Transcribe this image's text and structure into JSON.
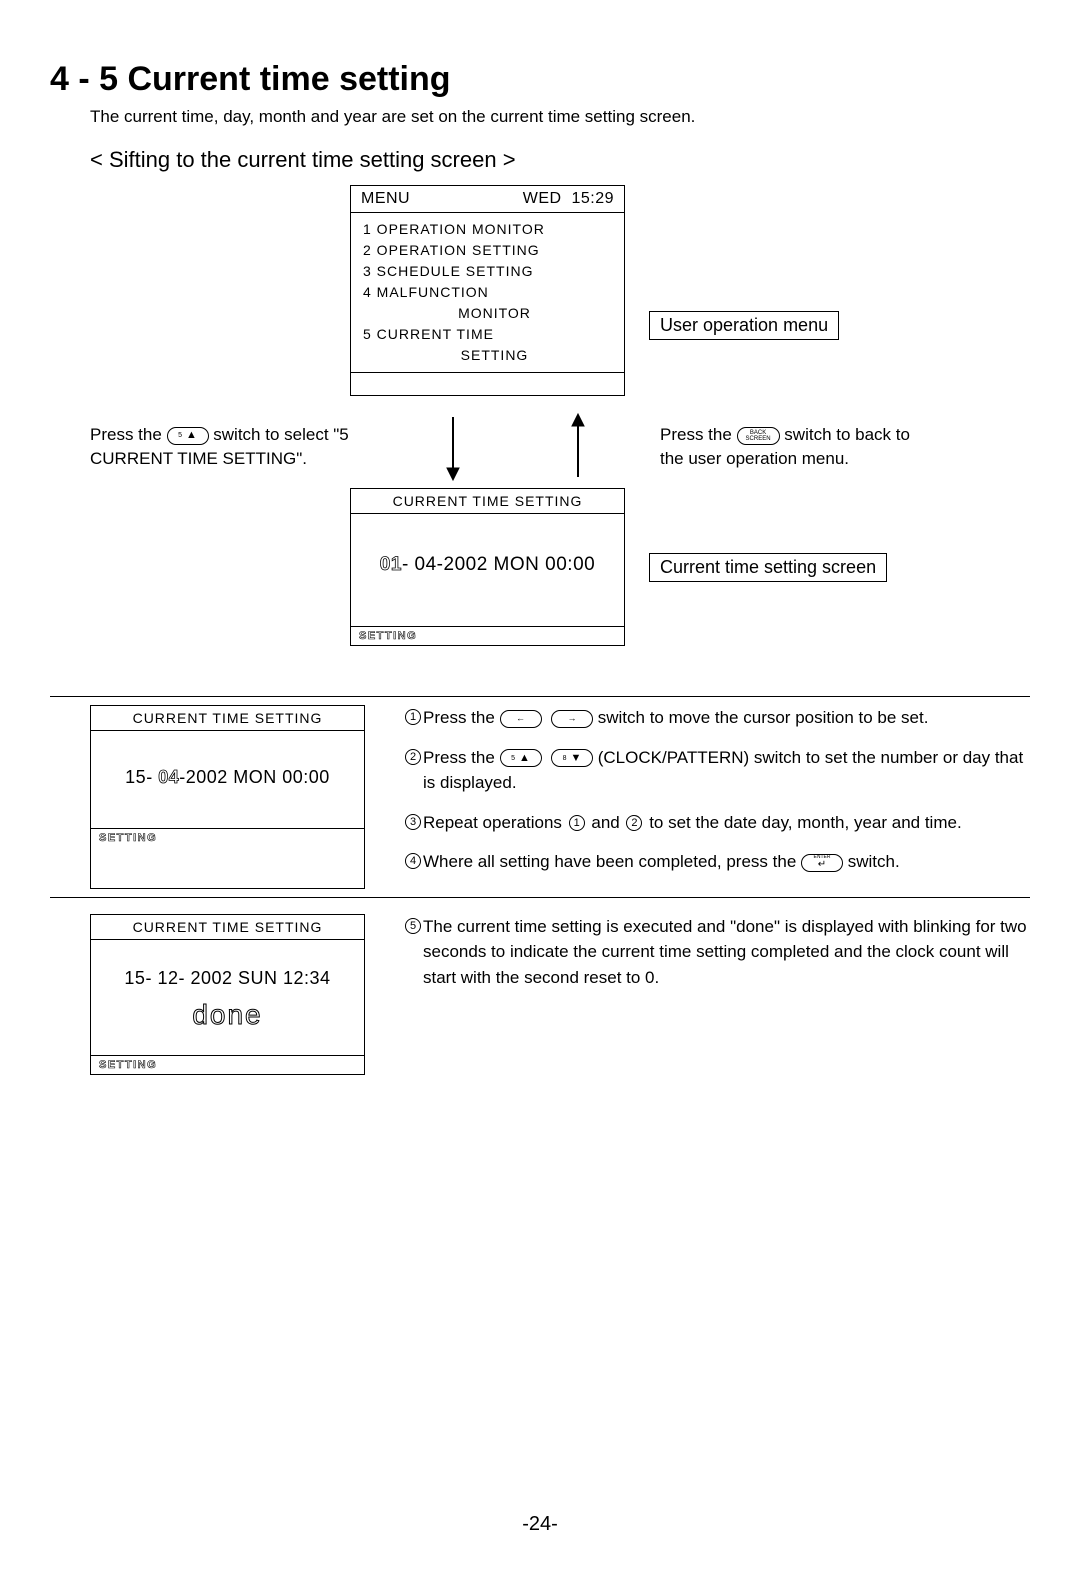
{
  "title": "4 - 5 Current time setting",
  "intro": "The current time, day, month and year are set on the current time setting screen.",
  "subhead": "< Sifting to the current time setting screen >",
  "menu": {
    "title": "MENU",
    "day": "WED",
    "time": "15:29",
    "items": [
      "1 OPERATION MONITOR",
      "2 OPERATION SETTING",
      "3 SCHEDULE SETTING",
      "4 MALFUNCTION",
      "5 CURRENT TIME"
    ],
    "sub4": "MONITOR",
    "sub5": "SETTING"
  },
  "label_user_menu": "User operation menu",
  "left_instr_pre": "Press the ",
  "left_instr_post": " switch to select \"5 CURRENT TIME SETTING\".",
  "right_instr_pre": "Press the ",
  "right_instr_post": " switch to back to the user operation menu.",
  "cts": {
    "title": "CURRENT TIME SETTING",
    "date_outline": "01",
    "date_rest": "- 04-2002  MON 00:00",
    "foot": "SETTING"
  },
  "label_cts_screen": "Current time setting screen",
  "cts2": {
    "date_pre": "15- ",
    "date_mid_outline": "04",
    "date_post": "-2002  MON 00:00"
  },
  "steps": {
    "s1_pre": "Press the ",
    "s1_post": " switch to move the cursor position to be set.",
    "s2_pre": "Press the ",
    "s2_post": " (CLOCK/PATTERN) switch to set the number or day that is displayed.",
    "s3_pre": "Repeat operations ",
    "s3_mid": " and ",
    "s3_post": " to set the date day, month, year and time.",
    "s4_pre": "Where all setting have been completed, press the ",
    "s4_post": " switch.",
    "s5": "The current time setting is executed and \"done\" is displayed with blinking for two seconds to indicate the current time setting completed and the clock count will start with the second reset to 0."
  },
  "cts3": {
    "date": "15- 12- 2002 SUN 12:34",
    "done": "done"
  },
  "page": "-24-"
}
